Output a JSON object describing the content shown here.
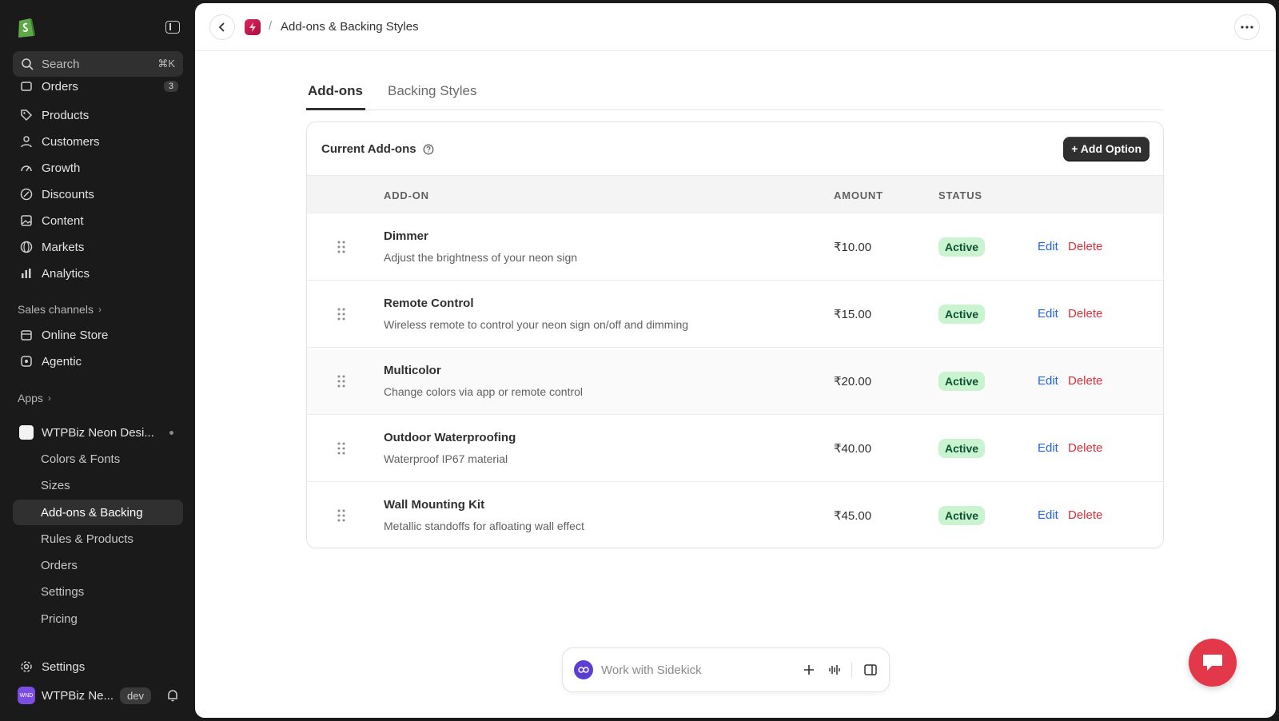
{
  "sidebar": {
    "search": {
      "placeholder": "Search",
      "shortcut": "⌘K"
    },
    "nav": [
      {
        "label": "Orders",
        "badge": "3"
      },
      {
        "label": "Products"
      },
      {
        "label": "Customers"
      },
      {
        "label": "Growth"
      },
      {
        "label": "Discounts"
      },
      {
        "label": "Content"
      },
      {
        "label": "Markets"
      },
      {
        "label": "Analytics"
      }
    ],
    "sales_channels_label": "Sales channels",
    "channels": [
      {
        "label": "Online Store"
      },
      {
        "label": "Agentic"
      }
    ],
    "apps_label": "Apps",
    "app_name": "WTPBiz Neon Desi...",
    "app_sub": [
      {
        "label": "Colors & Fonts"
      },
      {
        "label": "Sizes"
      },
      {
        "label": "Add-ons & Backing"
      },
      {
        "label": "Rules & Products"
      },
      {
        "label": "Orders"
      },
      {
        "label": "Settings"
      },
      {
        "label": "Pricing"
      }
    ],
    "settings_label": "Settings",
    "store": {
      "avatar_text": "WND",
      "name": "WTPBiz Ne...",
      "badge": "dev"
    }
  },
  "header": {
    "separator": "/",
    "title": "Add-ons & Backing Styles"
  },
  "tabs": [
    {
      "label": "Add-ons",
      "active": true
    },
    {
      "label": "Backing Styles",
      "active": false
    }
  ],
  "card": {
    "title": "Current Add-ons",
    "add_button": "+ Add Option",
    "columns": {
      "addon": "ADD-ON",
      "amount": "AMOUNT",
      "status": "STATUS"
    },
    "rows": [
      {
        "name": "Dimmer",
        "desc": "Adjust the brightness of your neon sign",
        "amount": "₹10.00",
        "status": "Active",
        "edit": "Edit",
        "delete": "Delete"
      },
      {
        "name": "Remote Control",
        "desc": "Wireless remote to control your neon sign on/off and dimming",
        "amount": "₹15.00",
        "status": "Active",
        "edit": "Edit",
        "delete": "Delete"
      },
      {
        "name": "Multicolor",
        "desc": "Change colors via app or remote control",
        "amount": "₹20.00",
        "status": "Active",
        "edit": "Edit",
        "delete": "Delete"
      },
      {
        "name": "Outdoor Waterproofing",
        "desc": "Waterproof IP67 material",
        "amount": "₹40.00",
        "status": "Active",
        "edit": "Edit",
        "delete": "Delete"
      },
      {
        "name": "Wall Mounting Kit",
        "desc": "Metallic standoffs for afloating wall effect",
        "amount": "₹45.00",
        "status": "Active",
        "edit": "Edit",
        "delete": "Delete"
      }
    ]
  },
  "sidekick": {
    "placeholder": "Work with Sidekick"
  },
  "colors": {
    "accent_dark": "#303030",
    "status_bg": "#c9f4cf",
    "link": "#2463eb",
    "danger": "#e22c38",
    "chat": "#e3384a"
  }
}
